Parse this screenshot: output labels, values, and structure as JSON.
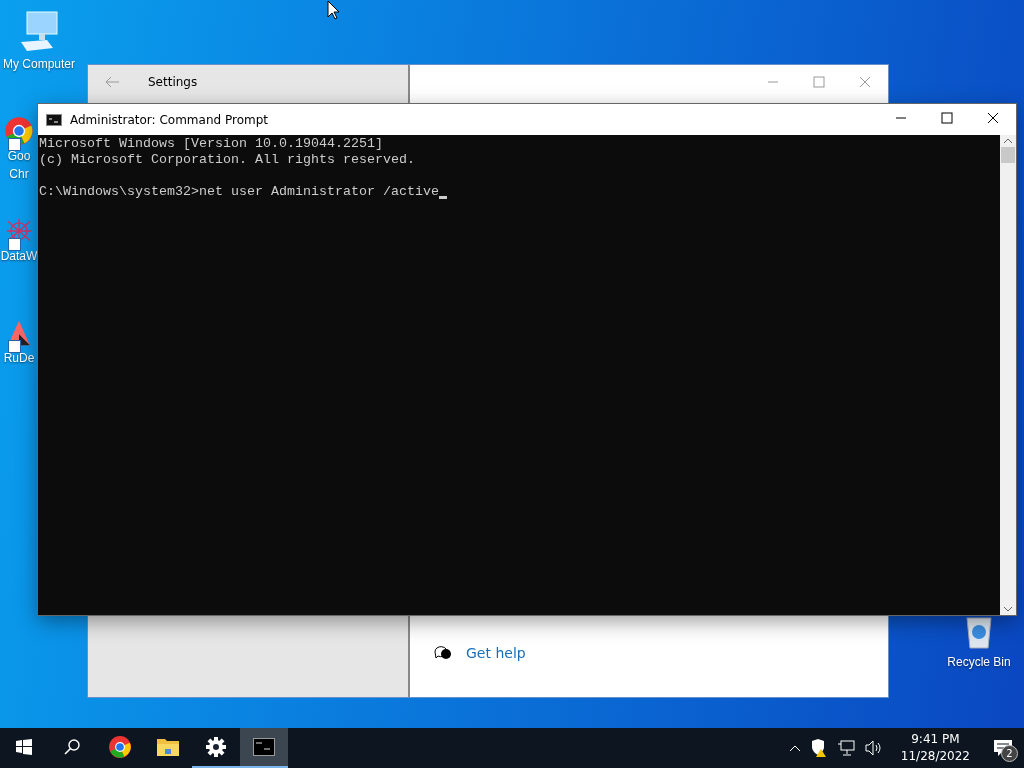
{
  "desktop_icons": [
    {
      "kind": "computer",
      "lines": [
        "My Computer"
      ]
    },
    {
      "kind": "chrome",
      "lines": [
        "Goo",
        "Chr"
      ]
    },
    {
      "kind": "dataw",
      "lines": [
        "DataW"
      ]
    },
    {
      "kind": "rude",
      "lines": [
        "RuDe"
      ]
    },
    {
      "kind": "recycle",
      "lines": [
        "Recycle Bin"
      ]
    }
  ],
  "settings_window": {
    "title": "Settings",
    "help_link": "Get help"
  },
  "cmd_window": {
    "title": "Administrator: Command Prompt",
    "output_lines": [
      "Microsoft Windows [Version 10.0.19044.2251]",
      "(c) Microsoft Corporation. All rights reserved."
    ],
    "prompt": "C:\\Windows\\system32>",
    "command": "net user Administrator /active"
  },
  "taskbar": {
    "apps": [
      {
        "kind": "start",
        "running": false,
        "selected": false
      },
      {
        "kind": "search",
        "running": false,
        "selected": false
      },
      {
        "kind": "chrome",
        "running": false,
        "selected": false
      },
      {
        "kind": "explorer",
        "running": false,
        "selected": false
      },
      {
        "kind": "settings",
        "running": true,
        "selected": false
      },
      {
        "kind": "cmd",
        "running": true,
        "selected": true
      }
    ],
    "time": "9:41 PM",
    "date": "11/28/2022",
    "notification_count": "2"
  }
}
